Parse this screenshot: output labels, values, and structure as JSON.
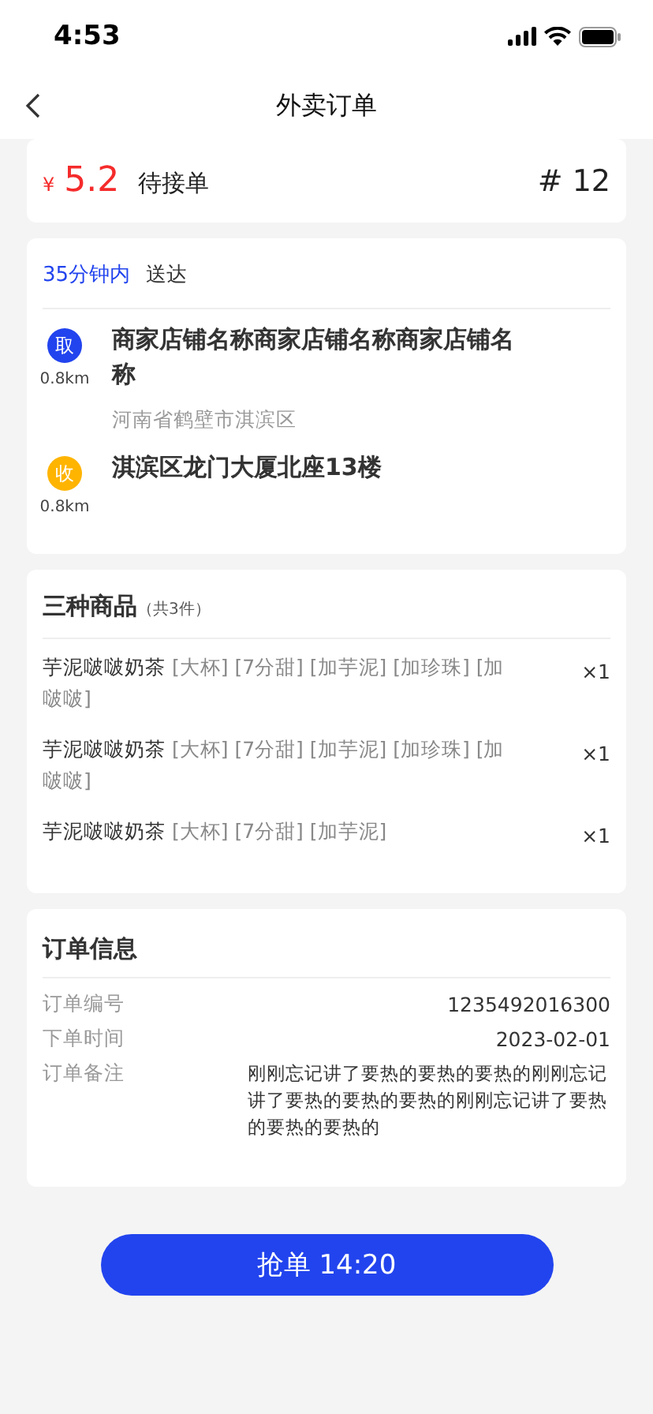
{
  "status_bar": {
    "time": "4:53"
  },
  "nav": {
    "title": "外卖订单"
  },
  "summary": {
    "currency": "¥",
    "price": "5.2",
    "status": "待接单",
    "number": "# 12"
  },
  "delivery": {
    "time": "35分钟内",
    "time_suffix": "送达",
    "points": [
      {
        "badge": "取",
        "color": "#2244ee",
        "distance": "0.8km",
        "name": "商家店铺名称商家店铺名称商家店铺名称",
        "address": "河南省鹤壁市淇滨区"
      },
      {
        "badge": "收",
        "color": "#ffb400",
        "distance": "0.8km",
        "name": "淇滨区龙门大厦北座13楼"
      }
    ]
  },
  "goods": {
    "title": "三种商品",
    "count": "（共3件）",
    "items": [
      {
        "name": "芋泥啵啵奶茶",
        "options": "[大杯] [7分甜] [加芋泥] [加珍珠] [加啵啵]",
        "qty": "×1"
      },
      {
        "name": "芋泥啵啵奶茶",
        "options": "[大杯] [7分甜] [加芋泥] [加珍珠] [加啵啵]",
        "qty": "×1"
      },
      {
        "name": "芋泥啵啵奶茶",
        "options": "[大杯] [7分甜] [加芋泥]",
        "qty": "×1"
      }
    ]
  },
  "order_info": {
    "title": "订单信息",
    "rows": [
      {
        "label": "订单编号",
        "value": "1235492016300"
      },
      {
        "label": "下单时间",
        "value": "2023-02-01"
      },
      {
        "label": "订单备注",
        "value": "刚刚忘记讲了要热的要热的要热的刚刚忘记讲了要热的要热的要热的刚刚忘记讲了要热的要热的要热的"
      }
    ]
  },
  "action_button": {
    "label": "抢单 14:20"
  }
}
